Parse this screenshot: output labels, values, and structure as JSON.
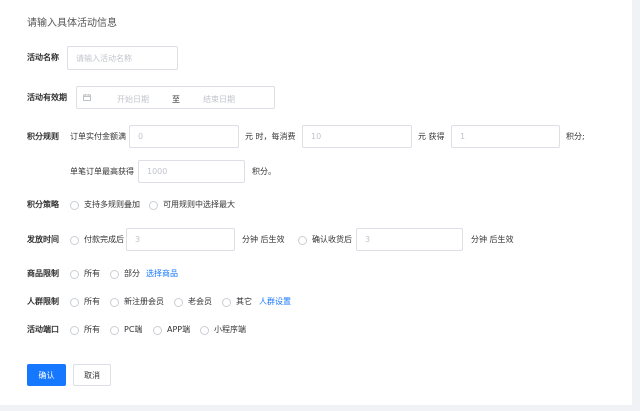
{
  "page": {
    "title": "请输入具体活动信息"
  },
  "activity_name": {
    "label": "活动名称",
    "placeholder": "请输入活动名称"
  },
  "validity": {
    "label": "活动有效期",
    "start_placeholder": "开始日期",
    "separator": "至",
    "end_placeholder": "结束日期"
  },
  "points_rule": {
    "label": "积分规则",
    "prefix": "订单实付金额满",
    "amount_value": "0",
    "yuan_when": "元  时，每消费",
    "per_spend_value": "10",
    "yuan_get": "元  获得",
    "points_value": "1",
    "points_suffix": "积分;",
    "max_prefix": "单笔订单最高获得",
    "max_value": "1000",
    "max_suffix": "积分。"
  },
  "points_strategy": {
    "label": "积分策略",
    "options": [
      "支持多规则叠加",
      "可用规则中选择最大"
    ]
  },
  "issue_time": {
    "label": "发放时间",
    "opt1": "付款完成后",
    "opt1_value": "3",
    "opt1_unit": "分钟  后生效",
    "opt2": "确认收货后",
    "opt2_value": "3",
    "opt2_unit": "分钟  后生效"
  },
  "product_limit": {
    "label": "商品限制",
    "options": [
      "所有",
      "部分"
    ],
    "link": "选择商品"
  },
  "audience_limit": {
    "label": "人群限制",
    "options": [
      "所有",
      "新注册会员",
      "老会员",
      "其它"
    ],
    "link": "人群设置"
  },
  "channels": {
    "label": "活动端口",
    "options": [
      "所有",
      "PC端",
      "APP端",
      "小程序端"
    ]
  },
  "buttons": {
    "confirm": "确认",
    "cancel": "取消"
  },
  "colors": {
    "primary": "#1677ff",
    "border": "#dcdfe6",
    "placeholder": "#c0c4cc"
  }
}
